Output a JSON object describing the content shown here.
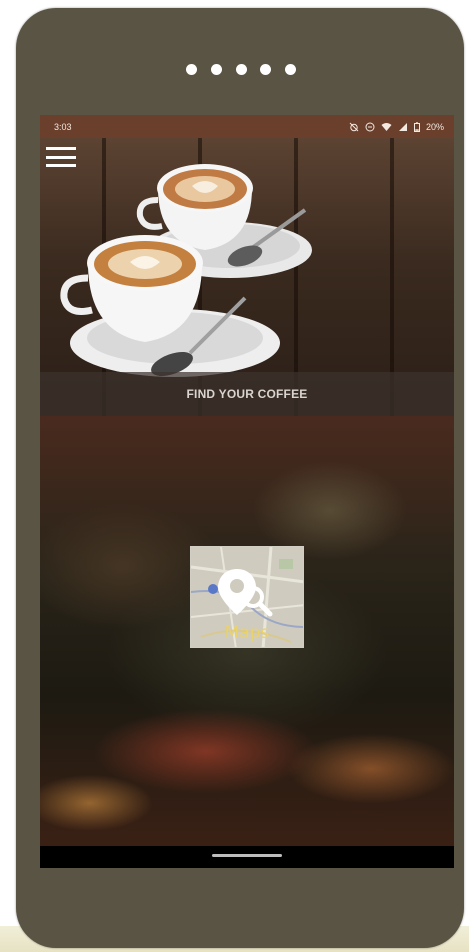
{
  "status_bar": {
    "time": "3:03",
    "battery_percent": "20%",
    "icons": [
      "muted-alarm-icon",
      "do-not-disturb-icon",
      "wifi-icon",
      "signal-icon",
      "battery-icon"
    ]
  },
  "menu": {
    "icon": "hamburger-menu-icon"
  },
  "hero": {
    "caption": "FIND YOUR COFFEE"
  },
  "maps_tile": {
    "label": "Maps",
    "icon": "map-search-pin-icon"
  },
  "colors": {
    "phone_body": "#5a5444",
    "status_bar": "#6a3f2c",
    "maps_label": "#e9d36a"
  }
}
